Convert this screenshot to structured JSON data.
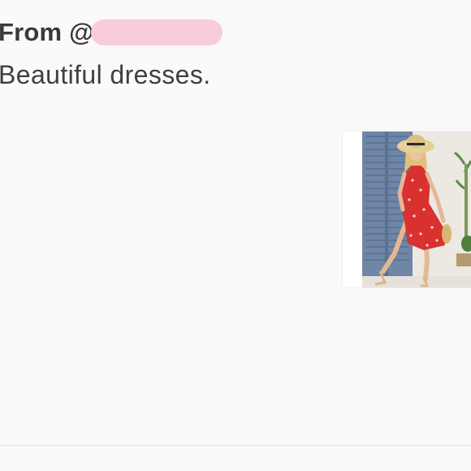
{
  "message": {
    "from_prefix": "From @",
    "text": "Beautiful dresses."
  },
  "product": {
    "image": "woman-in-red-floral-dress-icon"
  },
  "colors": {
    "background": "#fbf9f9",
    "redaction": "#f6cdd9",
    "text": "#3a3838",
    "dress_red": "#d9312f",
    "shutter_blue": "#6f86a6"
  }
}
